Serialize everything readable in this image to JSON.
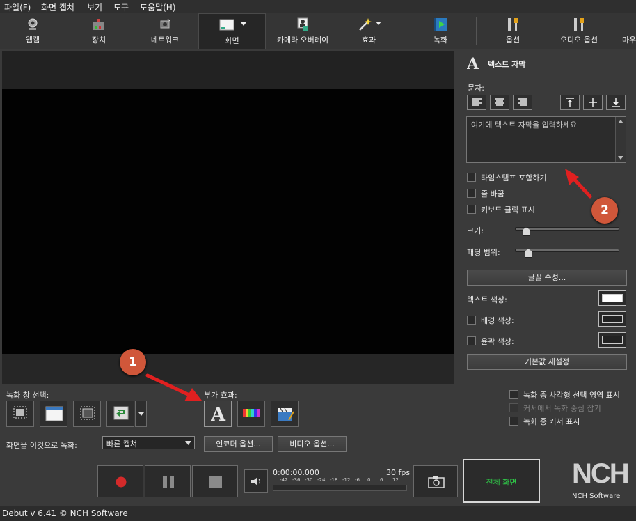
{
  "menu": [
    "파일(F)",
    "화면 캡쳐",
    "보기",
    "도구",
    "도움말(H)"
  ],
  "toolbar": [
    {
      "id": "webcam",
      "label": "웹캠",
      "icon": "webcam-icon"
    },
    {
      "id": "device",
      "label": "장치",
      "icon": "device-icon"
    },
    {
      "id": "network",
      "label": "네트워크",
      "icon": "network-icon"
    },
    {
      "id": "screen",
      "label": "화면",
      "icon": "screen-icon",
      "active": true
    },
    {
      "id": "camera_overlay",
      "label": "카메라 오버레이",
      "icon": "camera-overlay-icon"
    },
    {
      "id": "effects",
      "label": "효과",
      "icon": "magic-wand-icon"
    },
    {
      "id": "record",
      "label": "녹화",
      "icon": "record-film-icon"
    },
    {
      "id": "options",
      "label": "옵션",
      "icon": "tools-icon"
    },
    {
      "id": "audio_options",
      "label": "오디오 옵션",
      "icon": "audio-options-icon"
    },
    {
      "id": "more",
      "label": "마우",
      "icon": "mouse-icon"
    }
  ],
  "caption_panel": {
    "title": "텍스트 자막",
    "text_label": "문자:",
    "placeholder": "여기에 텍스트 자막을 입력하세요",
    "timestamp": "타임스탬프 포함하기",
    "word_wrap": "줄 바꿈",
    "keyboard_show": "키보드 클릭 표시",
    "size_label": "크기:",
    "padding_label": "패딩 범위:",
    "size_value": 0.1,
    "padding_value": 0.12,
    "font_button": "글꼴 속성...",
    "text_color": "텍스트 색상:",
    "bg_color": "배경 색상:",
    "outline_color": "윤곽 색상:",
    "reset_button": "기본값 재설정"
  },
  "cursor_options": {
    "show_rect": "녹화 중 사각형 선택 영역 표시",
    "hide_cursor": "커서에서 녹화 중심 잡기",
    "show_cursor": "녹화 중 커서 표시"
  },
  "record_select": {
    "label": "녹화 창 선택:"
  },
  "extra_effects": {
    "label": "부가 효과:"
  },
  "record_as": {
    "label": "화면을 이것으로 녹화:",
    "value": "빠른 캡쳐",
    "encoder_button": "인코더 옵션...",
    "video_button": "비디오 옵션..."
  },
  "transport": {
    "time": "0:00:00.000",
    "fps": "30 fps",
    "meter_ticks": [
      "-42",
      "-36",
      "-30",
      "-24",
      "-18",
      "-12",
      "-6",
      "0",
      "6",
      "12"
    ],
    "fullscreen": "전체 화면"
  },
  "brand": {
    "logo": "NCH",
    "name": "NCH Software"
  },
  "status": "Debut v 6.41 © NCH Software",
  "callouts": [
    "1",
    "2"
  ],
  "colors": {
    "accent_green": "#2fd34a",
    "callout": "#d0573a",
    "arrow": "#e02020"
  }
}
